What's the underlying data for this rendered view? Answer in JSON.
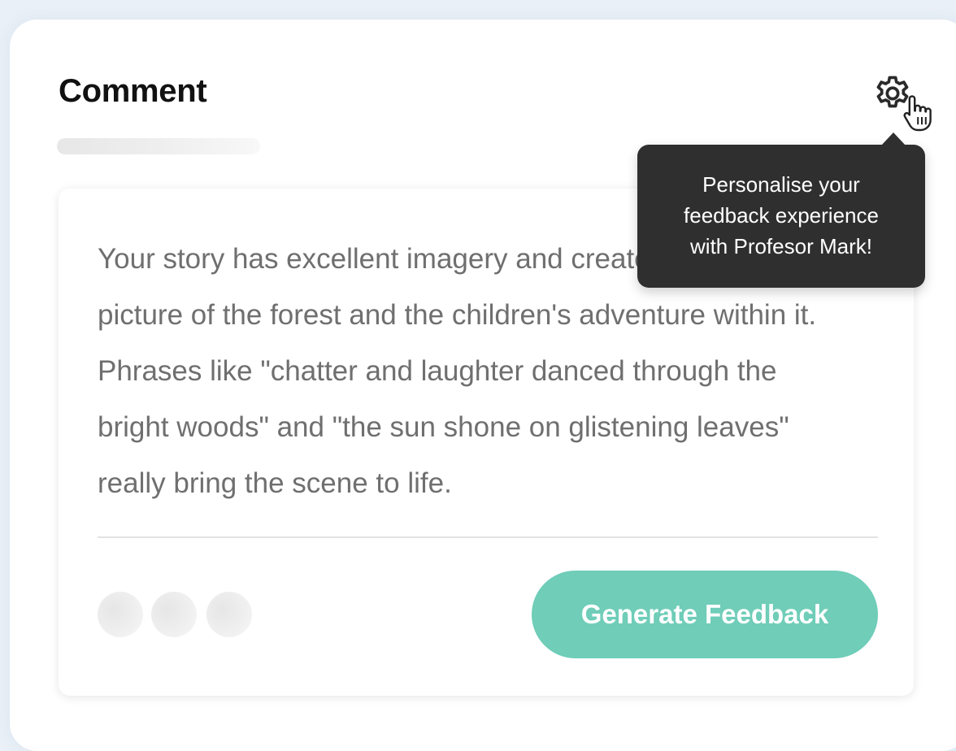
{
  "header": {
    "title": "Comment"
  },
  "tooltip": {
    "lines": [
      "Personalise your",
      "feedback experience",
      "with Profesor Mark!"
    ]
  },
  "comment": {
    "text": "Your story has excellent imagery and creates a vivid picture of the forest and the children's adventure within it. Phrases like \"chatter and laughter danced through the bright woods\" and \"the sun shone on glistening leaves\" really bring the scene to life."
  },
  "footer": {
    "generate_label": "Generate Feedback"
  },
  "icons": {
    "settings": "gear-icon",
    "cursor": "hand-pointer-icon"
  },
  "colors": {
    "accent": "#6fcdb8",
    "tooltip_bg": "#2f2f2f",
    "body_text": "#6f6f6f"
  }
}
